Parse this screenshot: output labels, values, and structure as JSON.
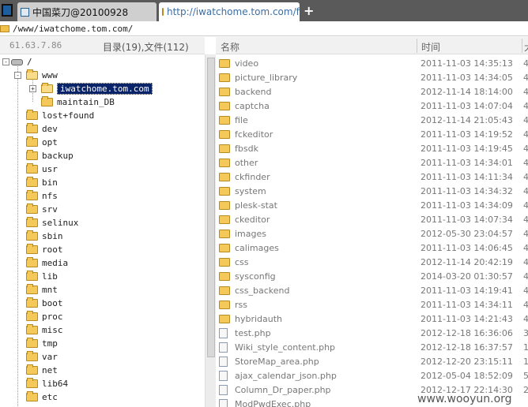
{
  "tabs": [
    {
      "label": "中国菜刀@20100928"
    },
    {
      "label": "http://iwatchome.tom.com/fil..."
    }
  ],
  "new_tab_label": "+",
  "address": "/www/iwatchome.tom.com/",
  "header": {
    "ip": "61.63.7.86",
    "dir_count": "目录(19),文件(112)",
    "col_name": "名称",
    "col_time": "时间",
    "col_size": "大"
  },
  "tree": [
    {
      "label": "/",
      "type": "drive",
      "level": 0,
      "expander": "-"
    },
    {
      "label": "www",
      "level": 1,
      "expander": "-",
      "open": true
    },
    {
      "label": "iwatchome.tom.com",
      "level": 2,
      "expander": "+",
      "selected": true,
      "open": true
    },
    {
      "label": "maintain_DB",
      "level": 2
    },
    {
      "label": "lost+found",
      "level": 1
    },
    {
      "label": "dev",
      "level": 1
    },
    {
      "label": "opt",
      "level": 1
    },
    {
      "label": "backup",
      "level": 1
    },
    {
      "label": "usr",
      "level": 1
    },
    {
      "label": "bin",
      "level": 1
    },
    {
      "label": "nfs",
      "level": 1
    },
    {
      "label": "srv",
      "level": 1
    },
    {
      "label": "selinux",
      "level": 1
    },
    {
      "label": "sbin",
      "level": 1
    },
    {
      "label": "root",
      "level": 1
    },
    {
      "label": "media",
      "level": 1
    },
    {
      "label": "lib",
      "level": 1
    },
    {
      "label": "mnt",
      "level": 1
    },
    {
      "label": "boot",
      "level": 1
    },
    {
      "label": "proc",
      "level": 1
    },
    {
      "label": "misc",
      "level": 1
    },
    {
      "label": "tmp",
      "level": 1
    },
    {
      "label": "var",
      "level": 1
    },
    {
      "label": "net",
      "level": 1
    },
    {
      "label": "lib64",
      "level": 1
    },
    {
      "label": "etc",
      "level": 1
    }
  ],
  "files": [
    {
      "name": "video",
      "time": "2011-11-03 14:35:13",
      "size": "4",
      "type": "folder"
    },
    {
      "name": "picture_library",
      "time": "2011-11-03 14:34:05",
      "size": "4",
      "type": "folder"
    },
    {
      "name": "backend",
      "time": "2012-11-14 18:14:00",
      "size": "4",
      "type": "folder"
    },
    {
      "name": "captcha",
      "time": "2011-11-03 14:07:04",
      "size": "4",
      "type": "folder"
    },
    {
      "name": "file",
      "time": "2012-11-14 21:05:43",
      "size": "4",
      "type": "folder"
    },
    {
      "name": "fckeditor",
      "time": "2011-11-03 14:19:52",
      "size": "4",
      "type": "folder"
    },
    {
      "name": "fbsdk",
      "time": "2011-11-03 14:19:45",
      "size": "4",
      "type": "folder"
    },
    {
      "name": "other",
      "time": "2011-11-03 14:34:01",
      "size": "4",
      "type": "folder"
    },
    {
      "name": "ckfinder",
      "time": "2011-11-03 14:11:34",
      "size": "4",
      "type": "folder"
    },
    {
      "name": "system",
      "time": "2011-11-03 14:34:32",
      "size": "4",
      "type": "folder"
    },
    {
      "name": "plesk-stat",
      "time": "2011-11-03 14:34:09",
      "size": "4",
      "type": "folder"
    },
    {
      "name": "ckeditor",
      "time": "2011-11-03 14:07:34",
      "size": "4",
      "type": "folder"
    },
    {
      "name": "images",
      "time": "2012-05-30 23:04:57",
      "size": "4",
      "type": "folder"
    },
    {
      "name": "calimages",
      "time": "2011-11-03 14:06:45",
      "size": "4",
      "type": "folder"
    },
    {
      "name": "css",
      "time": "2012-11-14 20:42:19",
      "size": "4",
      "type": "folder"
    },
    {
      "name": "sysconfig",
      "time": "2014-03-20 01:30:57",
      "size": "4",
      "type": "folder"
    },
    {
      "name": "css_backend",
      "time": "2011-11-03 14:19:41",
      "size": "4",
      "type": "folder"
    },
    {
      "name": "rss",
      "time": "2011-11-03 14:34:11",
      "size": "4",
      "type": "folder"
    },
    {
      "name": "hybridauth",
      "time": "2011-11-03 14:21:43",
      "size": "4",
      "type": "folder"
    },
    {
      "name": "test.php",
      "time": "2012-12-18 16:36:06",
      "size": "3",
      "type": "file"
    },
    {
      "name": "Wiki_style_content.php",
      "time": "2012-12-18 16:37:57",
      "size": "1",
      "type": "file"
    },
    {
      "name": "StoreMap_area.php",
      "time": "2012-12-20 23:15:11",
      "size": "1",
      "type": "file"
    },
    {
      "name": "ajax_calendar_json.php",
      "time": "2012-05-04 18:52:09",
      "size": "5",
      "type": "file"
    },
    {
      "name": "Column_Dr_paper.php",
      "time": "2012-12-17 22:14:30",
      "size": "2",
      "type": "file"
    },
    {
      "name": "ModPwdExec.php",
      "time": "",
      "size": "",
      "type": "file"
    }
  ],
  "watermark": "www.wooyun.org"
}
